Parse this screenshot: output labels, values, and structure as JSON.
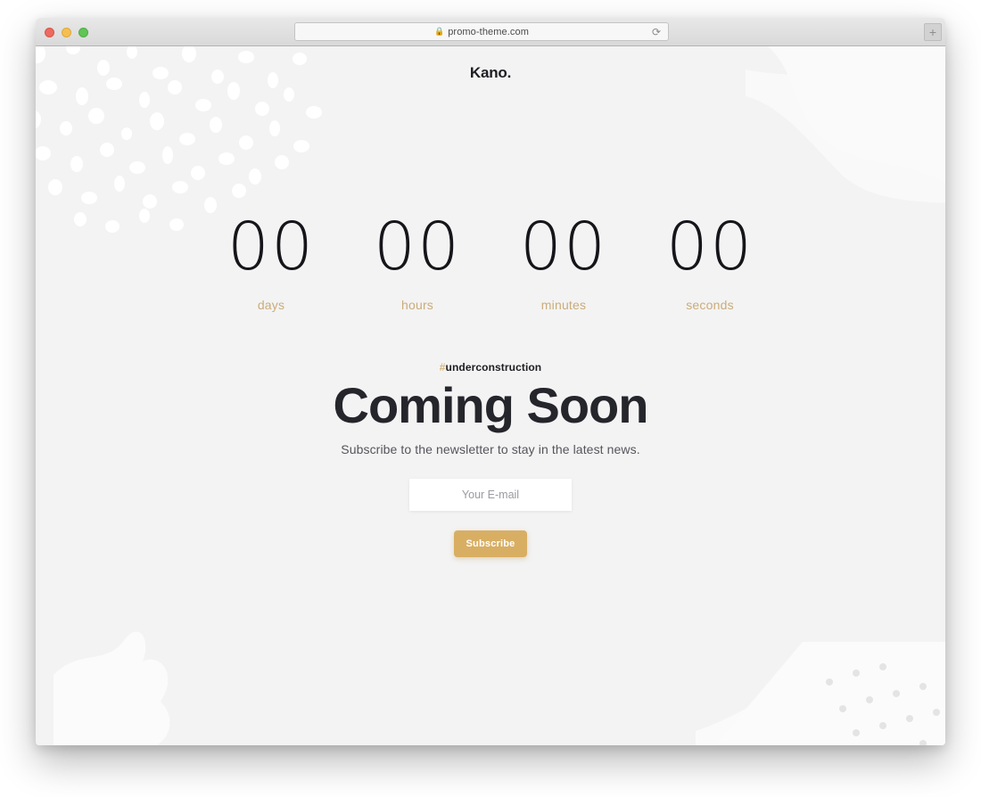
{
  "browser": {
    "traffic_lights": [
      {
        "name": "close",
        "color": "#ec6a5f"
      },
      {
        "name": "minimize",
        "color": "#f5bf4f"
      },
      {
        "name": "maximize",
        "color": "#61c454"
      }
    ],
    "url": "promo-theme.com",
    "lock_icon": "lock-icon",
    "reload_icon": "reload-icon",
    "reload_glyph": "⟳",
    "newtab_icon": "plus-icon",
    "newtab_glyph": "+"
  },
  "site": {
    "logo": "Kano.",
    "countdown": {
      "units": [
        {
          "value": "00",
          "label": "days"
        },
        {
          "value": "00",
          "label": "hours"
        },
        {
          "value": "00",
          "label": "minutes"
        },
        {
          "value": "00",
          "label": "seconds"
        }
      ]
    },
    "hashtag": {
      "symbol": "#",
      "text": "underconstruction"
    },
    "headline": "Coming Soon",
    "subtext": "Subscribe to the newsletter to stay in the latest news.",
    "email_field": {
      "placeholder": "Your E-mail",
      "value": ""
    },
    "subscribe_label": "Subscribe",
    "colors": {
      "background": "#f3f3f3",
      "accent_gold": "#d8ae63",
      "label_gold": "#cbac79",
      "text_dark": "#1e1e23",
      "text_muted": "#55555c"
    }
  }
}
